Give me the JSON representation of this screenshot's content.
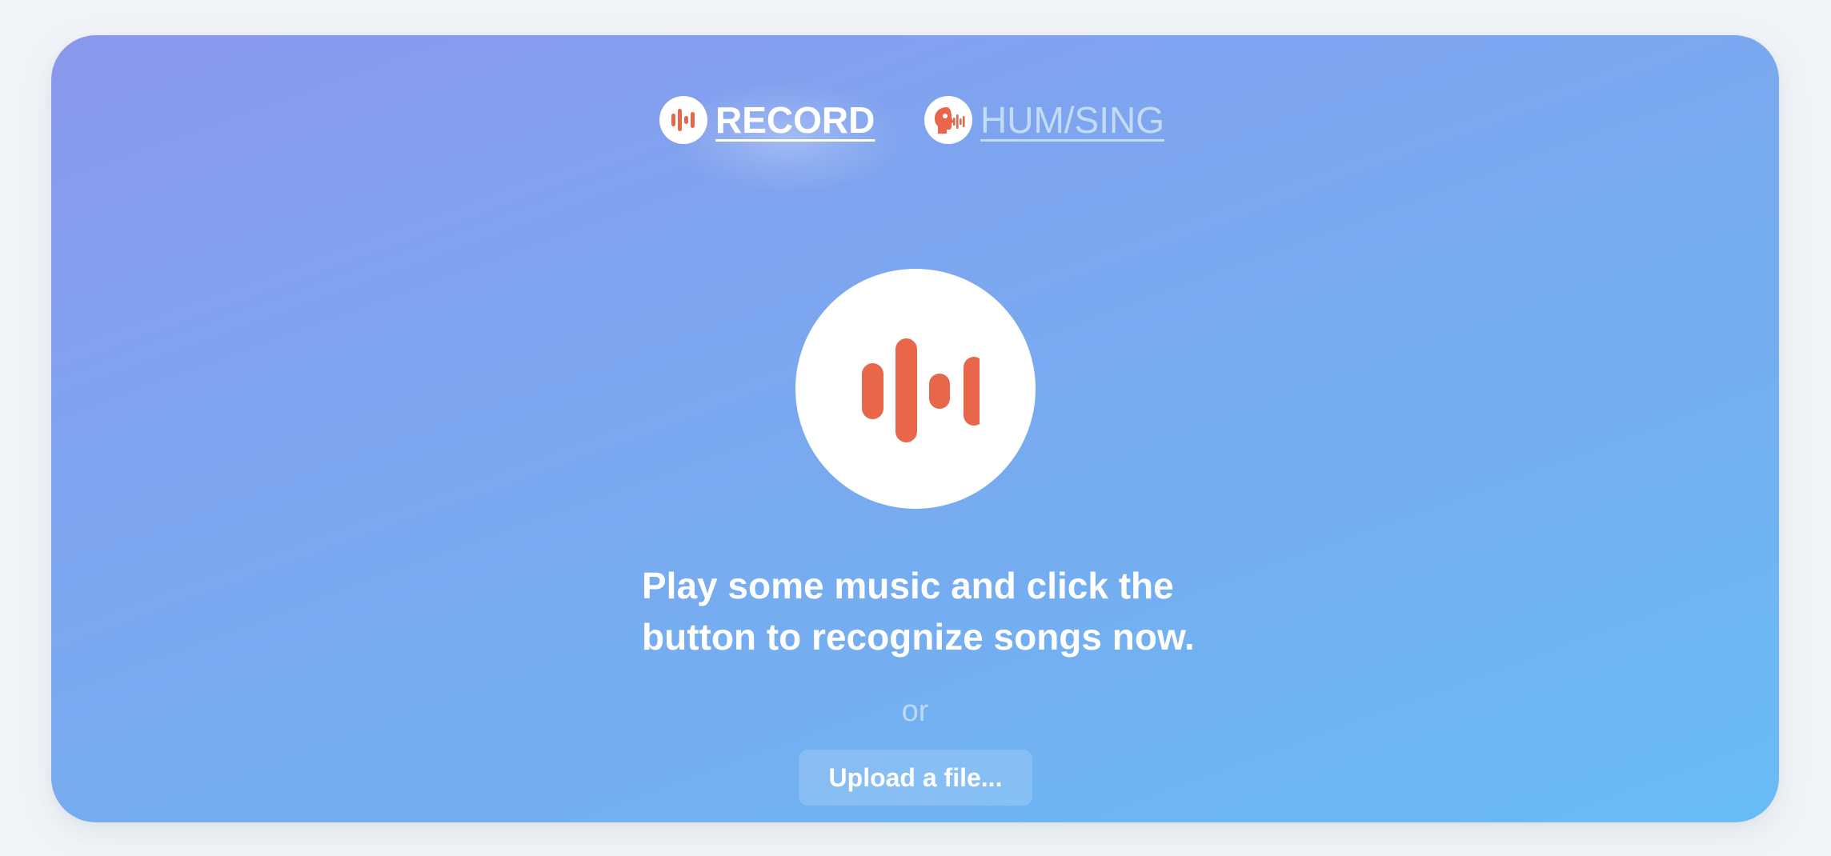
{
  "tabs": [
    {
      "label": "RECORD",
      "icon": "sound-wave-icon",
      "active": true
    },
    {
      "label": "HUM/SING",
      "icon": "singing-head-icon",
      "active": false
    }
  ],
  "main": {
    "record_button_icon": "sound-wave-icon",
    "prompt": "Play some music and click the\nbutton to recognize songs now.",
    "or_text": "or",
    "upload_label": "Upload a file..."
  },
  "colors": {
    "accent": "#e8664a",
    "gradient_start": "#8b97ec",
    "gradient_end": "#68bcf6",
    "inactive_tab": "#c2dcf8"
  }
}
